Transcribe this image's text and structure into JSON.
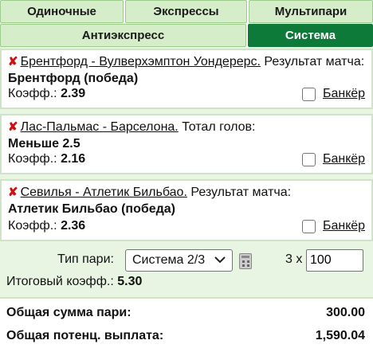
{
  "tabs_top": [
    "Одиночные",
    "Экспрессы",
    "Мультипари"
  ],
  "tabs_bottom": [
    "Антиэкспресс",
    "Система"
  ],
  "active_tab": "Система",
  "bets": [
    {
      "event": "Брентфорд - Вулверхэмптон Уондерерс.",
      "market": "Результат матча:",
      "selection": "Брентфорд (победа)",
      "odds_label": "Коэфф.:",
      "odds": "2.39",
      "banker_label": "Банкёр"
    },
    {
      "event": "Лас-Пальмас - Барселона.",
      "market": "Тотал голов:",
      "selection": "Меньше 2.5",
      "odds_label": "Коэфф.:",
      "odds": "2.16",
      "banker_label": "Банкёр"
    },
    {
      "event": "Севилья - Атлетик Бильбао.",
      "market": "Результат матча:",
      "selection": "Атлетик Бильбао (победа)",
      "odds_label": "Коэфф.:",
      "odds": "2.36",
      "banker_label": "Банкёр"
    }
  ],
  "system": {
    "type_label": "Тип пари:",
    "type_value": "Система 2/3",
    "multiplier": "3 x",
    "stake": "100",
    "total_odds_label": "Итоговый коэфф.:",
    "total_odds": "5.30"
  },
  "summary": {
    "total_stake_label": "Общая сумма пари:",
    "total_stake": "300.00",
    "potential_payout_label": "Общая потенц. выплата:",
    "potential_payout": "1,590.04"
  },
  "colors": {
    "accent": "#0e7a3a",
    "tab_bg": "#d6edca",
    "panel_bg": "#e8f5e3",
    "remove": "#cc1111"
  }
}
